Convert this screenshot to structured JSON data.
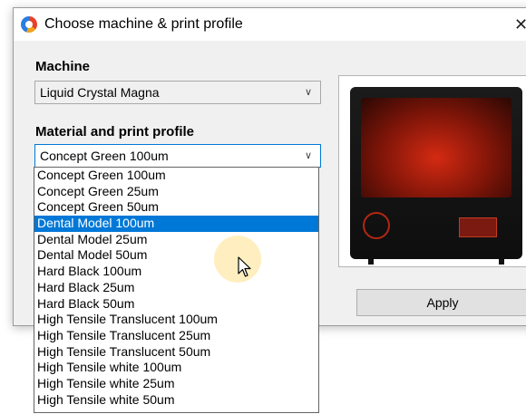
{
  "dialog": {
    "title": "Choose machine & print profile",
    "close_glyph": "✕"
  },
  "machine": {
    "label": "Machine",
    "value": "Liquid Crystal Magna"
  },
  "material": {
    "label": "Material and print profile",
    "value": "Concept Green 100um",
    "options": [
      "Concept Green 100um",
      "Concept Green 25um",
      "Concept Green 50um",
      "Dental Model 100um",
      "Dental Model 25um",
      "Dental Model 50um",
      "Hard Black 100um",
      "Hard Black 25um",
      "Hard Black 50um",
      "High Tensile Translucent  100um",
      "High Tensile Translucent  25um",
      "High Tensile Translucent  50um",
      "High Tensile white 100um",
      "High Tensile white 25um",
      "High Tensile white 50um"
    ],
    "highlighted_index": 3
  },
  "apply_label": "Apply",
  "icons": {
    "app": "app-logo-icon",
    "close": "close-icon",
    "dropdown": "chevron-down-icon",
    "cursor": "mouse-pointer-icon"
  },
  "colors": {
    "highlight": "#0078d7",
    "focus_border": "#0078d7",
    "dialog_bg": "#f0f0f0"
  }
}
